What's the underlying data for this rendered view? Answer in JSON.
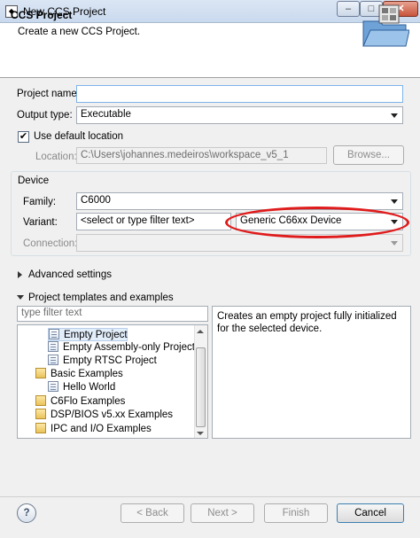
{
  "window": {
    "title": "New CCS Project",
    "minimize": "–",
    "maximize": "□",
    "close": "✕"
  },
  "banner": {
    "title": "CCS Project",
    "description": "Create a new CCS Project."
  },
  "form": {
    "project_name_label": "Project name:",
    "project_name_value": "",
    "output_type_label": "Output type:",
    "output_type_value": "Executable",
    "use_default_location_label": "Use default location",
    "use_default_location_checked": true,
    "location_label": "Location:",
    "location_value": "C:\\Users\\johannes.medeiros\\workspace_v5_1",
    "browse_label": "Browse..."
  },
  "device": {
    "group_label": "Device",
    "family_label": "Family:",
    "family_value": "C6000",
    "variant_label": "Variant:",
    "variant_filter_placeholder": "<select or type filter text>",
    "variant_value": "Generic C66xx Device",
    "connection_label": "Connection:",
    "connection_value": ""
  },
  "sections": {
    "advanced_settings": "Advanced settings",
    "templates": "Project templates and examples"
  },
  "templates": {
    "filter_placeholder": "type filter text",
    "items": [
      {
        "label": "Empty Project",
        "icon": "document-icon",
        "selected": true
      },
      {
        "label": "Empty Assembly-only Project",
        "icon": "document-icon",
        "selected": false
      },
      {
        "label": "Empty RTSC Project",
        "icon": "document-icon",
        "selected": false
      },
      {
        "label": "Basic Examples",
        "icon": "folder-icon",
        "selected": false
      },
      {
        "label": "Hello World",
        "icon": "document-icon",
        "selected": false
      },
      {
        "label": "C6Flo Examples",
        "icon": "folder-icon",
        "selected": false
      },
      {
        "label": "DSP/BIOS v5.xx Examples",
        "icon": "folder-icon",
        "selected": false
      },
      {
        "label": "IPC and I/O Examples",
        "icon": "folder-icon",
        "selected": false
      }
    ],
    "description": "Creates an empty project fully initialized for the selected device."
  },
  "buttons": {
    "help": "?",
    "back": "< Back",
    "next": "Next >",
    "finish": "Finish",
    "cancel": "Cancel"
  },
  "colors": {
    "annotation": "#e01b1b",
    "selection": "#e3eefb"
  }
}
